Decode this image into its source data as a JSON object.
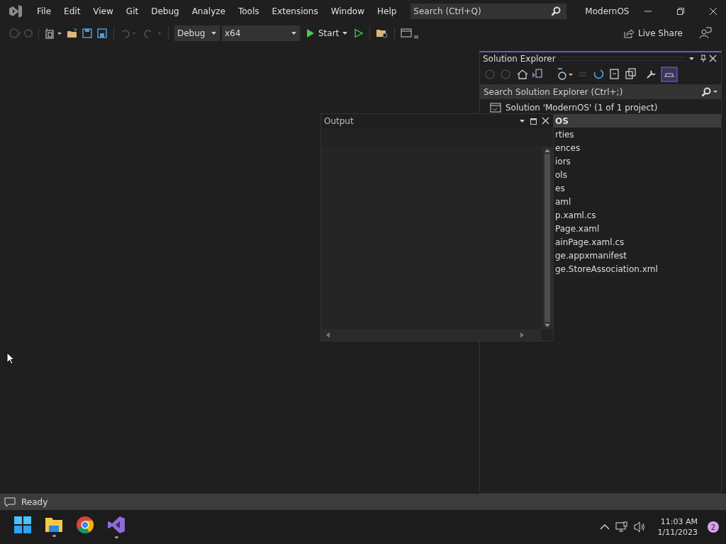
{
  "window": {
    "title": "ModernOS"
  },
  "menu": [
    "File",
    "Edit",
    "View",
    "Git",
    "Debug",
    "Analyze",
    "Tools",
    "Extensions",
    "Window",
    "Help"
  ],
  "search": {
    "placeholder": "Search (Ctrl+Q)"
  },
  "toolbar": {
    "configuration": "Debug",
    "platform": "x64",
    "start": "Start",
    "live_share": "Live Share"
  },
  "solution_explorer": {
    "title": "Solution Explorer",
    "search": {
      "placeholder": "Search Solution Explorer (Ctrl+;)"
    },
    "solution": "Solution 'ModernOS' (1 of 1 project)",
    "items": [
      {
        "label": "OS",
        "selected": true
      },
      {
        "label": "rties",
        "selected": false
      },
      {
        "label": "ences",
        "selected": false
      },
      {
        "label": "iors",
        "selected": false
      },
      {
        "label": "ols",
        "selected": false
      },
      {
        "label": "es",
        "selected": false
      },
      {
        "label": "aml",
        "selected": false
      },
      {
        "label": "p.xaml.cs",
        "selected": false
      },
      {
        "label": "Page.xaml",
        "selected": false
      },
      {
        "label": "ainPage.xaml.cs",
        "selected": false
      },
      {
        "label": "ge.appxmanifest",
        "selected": false
      },
      {
        "label": "ge.StoreAssociation.xml",
        "selected": false
      }
    ]
  },
  "output_window": {
    "title": "Output"
  },
  "status_bar": {
    "text": "Ready"
  },
  "taskbar": {
    "apps": [
      {
        "kind": "start",
        "running": false
      },
      {
        "kind": "files",
        "running": true
      },
      {
        "kind": "browser",
        "running": false
      },
      {
        "kind": "studio",
        "running": true
      }
    ],
    "time": "11:03 AM",
    "date": "1/11/2023",
    "notifications": "2"
  }
}
